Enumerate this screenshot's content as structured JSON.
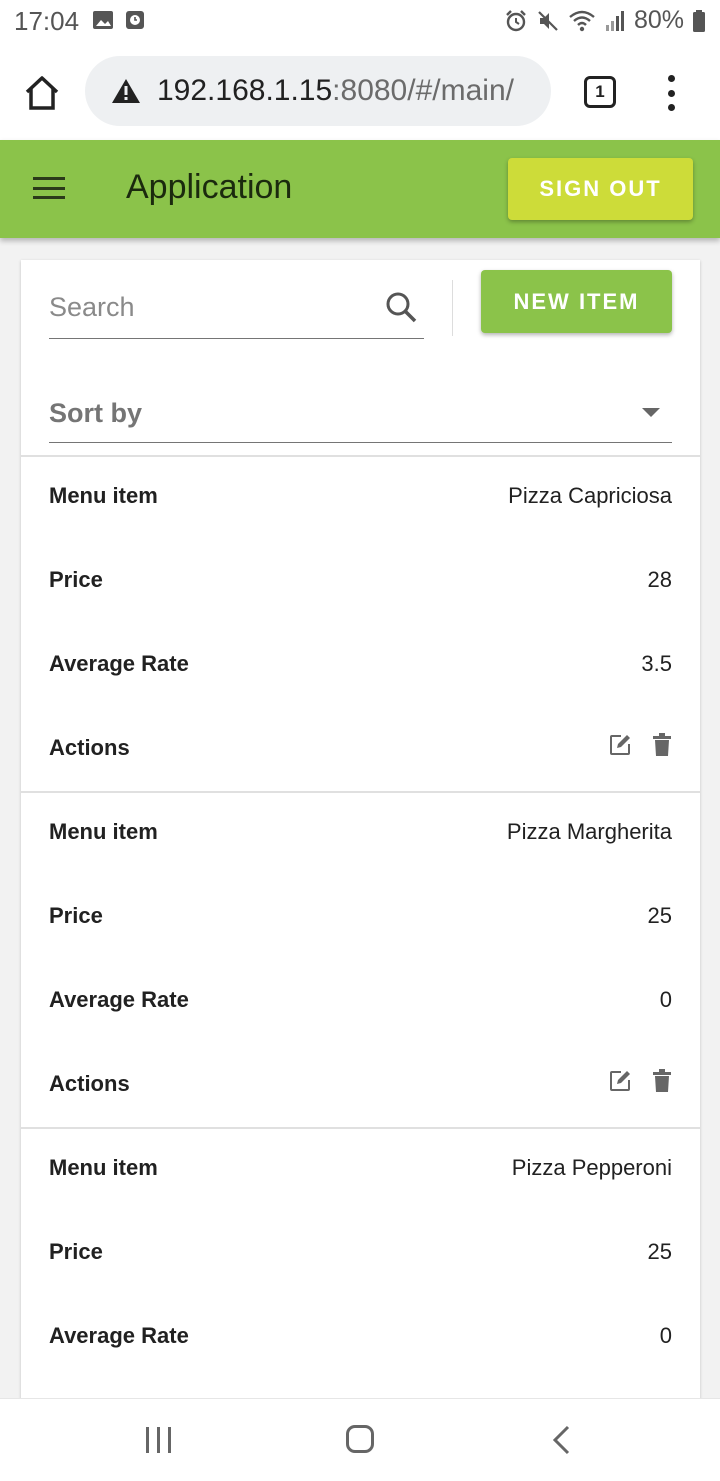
{
  "status_bar": {
    "time": "17:04",
    "battery": "80%"
  },
  "browser": {
    "url_host": "192.168.1.15",
    "url_rest": ":8080/#/main/",
    "tab_count": "1"
  },
  "appbar": {
    "title": "Application",
    "signout_label": "SIGN OUT"
  },
  "toolbar": {
    "search_placeholder": "Search",
    "new_item_label": "NEW ITEM",
    "sort_label": "Sort by"
  },
  "labels": {
    "menu_item": "Menu item",
    "price": "Price",
    "avg_rate": "Average Rate",
    "actions": "Actions"
  },
  "items": [
    {
      "name": "Pizza Capriciosa",
      "price": "28",
      "avg_rate": "3.5"
    },
    {
      "name": "Pizza Margherita",
      "price": "25",
      "avg_rate": "0"
    },
    {
      "name": "Pizza Pepperoni",
      "price": "25",
      "avg_rate": "0"
    }
  ],
  "colors": {
    "primary": "#8bc34a",
    "accent": "#cddc39"
  }
}
